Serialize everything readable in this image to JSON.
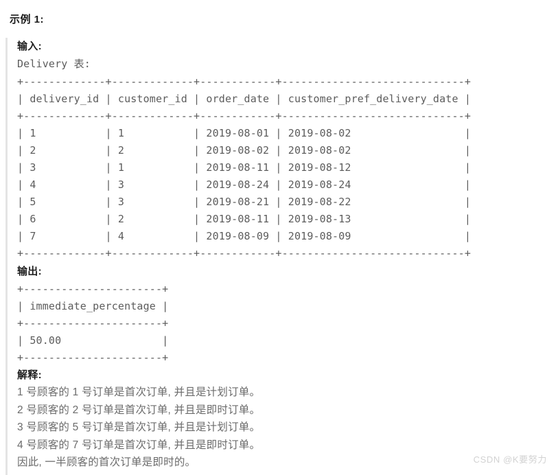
{
  "page": {
    "title": "示例 1:",
    "watermark": "CSDN @K要努力"
  },
  "input_section": {
    "label": "输入:",
    "table_name": "Delivery 表:",
    "table_text": "+-------------+-------------+------------+-----------------------------+\n| delivery_id | customer_id | order_date | customer_pref_delivery_date |\n+-------------+-------------+------------+-----------------------------+\n| 1           | 1           | 2019-08-01 | 2019-08-02                  |\n| 2           | 2           | 2019-08-02 | 2019-08-02                  |\n| 3           | 1           | 2019-08-11 | 2019-08-12                  |\n| 4           | 3           | 2019-08-24 | 2019-08-24                  |\n| 5           | 3           | 2019-08-21 | 2019-08-22                  |\n| 6           | 2           | 2019-08-11 | 2019-08-13                  |\n| 7           | 4           | 2019-08-09 | 2019-08-09                  |\n+-------------+-------------+------------+-----------------------------+",
    "table": {
      "columns": [
        "delivery_id",
        "customer_id",
        "order_date",
        "customer_pref_delivery_date"
      ],
      "rows": [
        [
          "1",
          "1",
          "2019-08-01",
          "2019-08-02"
        ],
        [
          "2",
          "2",
          "2019-08-02",
          "2019-08-02"
        ],
        [
          "3",
          "1",
          "2019-08-11",
          "2019-08-12"
        ],
        [
          "4",
          "3",
          "2019-08-24",
          "2019-08-24"
        ],
        [
          "5",
          "3",
          "2019-08-21",
          "2019-08-22"
        ],
        [
          "6",
          "2",
          "2019-08-11",
          "2019-08-13"
        ],
        [
          "7",
          "4",
          "2019-08-09",
          "2019-08-09"
        ]
      ]
    }
  },
  "output_section": {
    "label": "输出:",
    "table_text": "+----------------------+\n| immediate_percentage |\n+----------------------+\n| 50.00                |\n+----------------------+",
    "table": {
      "columns": [
        "immediate_percentage"
      ],
      "rows": [
        [
          "50.00"
        ]
      ]
    }
  },
  "explain_section": {
    "label": "解释:",
    "lines": [
      "1 号顾客的 1 号订单是首次订单, 并且是计划订单。",
      "2 号顾客的 2 号订单是首次订单, 并且是即时订单。",
      "3 号顾客的 5 号订单是首次订单, 并且是计划订单。",
      "4 号顾客的 7 号订单是首次订单, 并且是即时订单。",
      "因此, 一半顾客的首次订单是即时的。"
    ]
  }
}
